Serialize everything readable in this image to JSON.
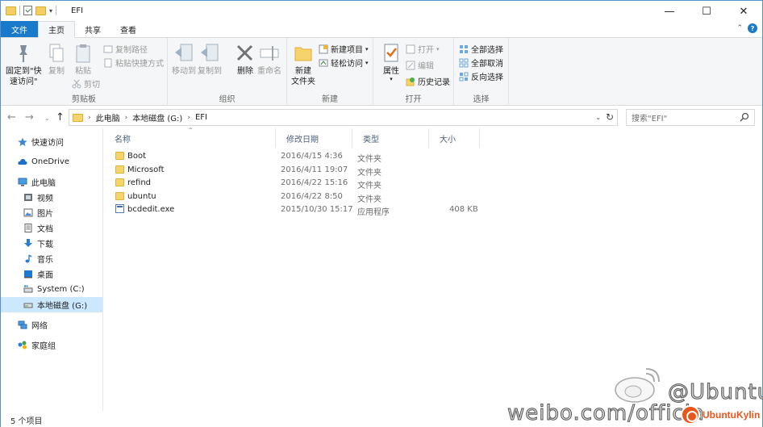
{
  "window": {
    "title": "EFI"
  },
  "tabs": [
    "文件",
    "主页",
    "共享",
    "查看"
  ],
  "ribbon": {
    "clipboard": {
      "label": "剪贴板",
      "pin_line1": "固定到\"快",
      "pin_line2": "速访问\"",
      "copy": "复制",
      "paste": "粘贴",
      "copy_path": "复制路径",
      "paste_shortcut": "粘贴快捷方式",
      "cut": "剪切"
    },
    "organize": {
      "label": "组织",
      "move_to": "移动到",
      "copy_to": "复制到",
      "delete": "删除",
      "rename": "重命名"
    },
    "new": {
      "label": "新建",
      "new_folder_line1": "新建",
      "new_folder_line2": "文件夹",
      "new_item": "新建项目",
      "easy_access": "轻松访问"
    },
    "open": {
      "label": "打开",
      "properties": "属性",
      "open": "打开",
      "edit": "编辑",
      "history": "历史记录"
    },
    "select": {
      "label": "选择",
      "select_all": "全部选择",
      "select_none": "全部取消",
      "invert": "反向选择"
    }
  },
  "address": {
    "segments": [
      "此电脑",
      "本地磁盘 (G:)",
      "EFI"
    ]
  },
  "search": {
    "placeholder": "搜索\"EFI\""
  },
  "nav": {
    "quick_access": "快速访问",
    "onedrive": "OneDrive",
    "this_pc": "此电脑",
    "videos": "视频",
    "pictures": "图片",
    "documents": "文档",
    "downloads": "下载",
    "music": "音乐",
    "desktop": "桌面",
    "system_c": "System (C:)",
    "local_g": "本地磁盘 (G:)",
    "network": "网络",
    "homegroup": "家庭组"
  },
  "columns": {
    "name": "名称",
    "date": "修改日期",
    "type": "类型",
    "size": "大小"
  },
  "files": [
    {
      "name": "Boot",
      "date": "2016/4/15 4:36",
      "type": "文件夹",
      "size": ""
    },
    {
      "name": "Microsoft",
      "date": "2016/4/11 19:07",
      "type": "文件夹",
      "size": ""
    },
    {
      "name": "refind",
      "date": "2016/4/22 15:16",
      "type": "文件夹",
      "size": ""
    },
    {
      "name": "ubuntu",
      "date": "2016/4/22 8:50",
      "type": "文件夹",
      "size": ""
    },
    {
      "name": "bcdedit.exe",
      "date": "2015/10/30 15:17",
      "type": "应用程序",
      "size": "408 KB"
    }
  ],
  "status": {
    "item_count": "5 个项目"
  },
  "watermark": {
    "handle": "@Ubuntu",
    "url": "weibo.com/officia",
    "brand": "UbuntuKylin"
  }
}
